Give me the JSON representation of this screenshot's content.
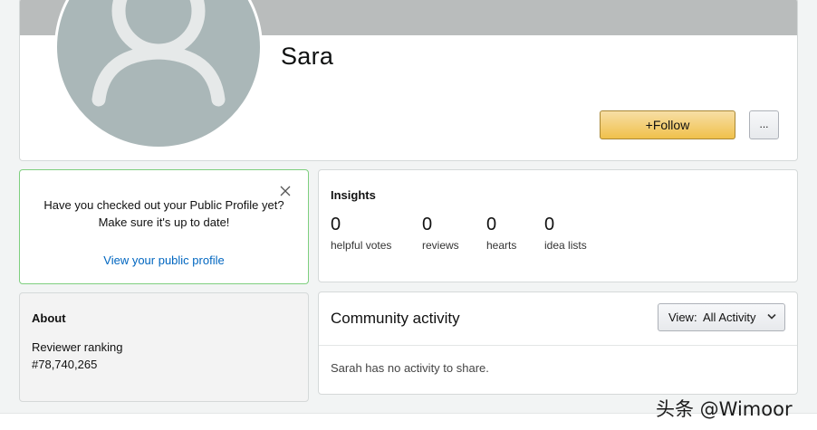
{
  "profile": {
    "name": "Sara",
    "follow_label": "+Follow",
    "more_label": "..."
  },
  "prompt": {
    "line1": "Have you checked out your Public Profile yet?",
    "line2": "Make sure it's up to date!",
    "link": "View your public profile"
  },
  "about": {
    "title": "About",
    "ranking_label": "Reviewer ranking",
    "ranking_value": "#78,740,265"
  },
  "insights": {
    "title": "Insights",
    "stats": [
      {
        "value": "0",
        "label": "helpful votes"
      },
      {
        "value": "0",
        "label": "reviews"
      },
      {
        "value": "0",
        "label": "hearts"
      },
      {
        "value": "0",
        "label": "idea lists"
      }
    ]
  },
  "activity": {
    "title": "Community activity",
    "view_label": "View:",
    "view_value": "All Activity",
    "empty_text": "Sarah has no activity to share."
  },
  "watermark": "头条 @Wimoor",
  "icons": [
    "avatar-placeholder-icon",
    "close-icon",
    "chevron-down-icon"
  ],
  "colors": {
    "follow_button": "#f0c14b",
    "link": "#0066c0",
    "prompt_border": "#7fcf7f",
    "avatar": "#aab7b8"
  }
}
